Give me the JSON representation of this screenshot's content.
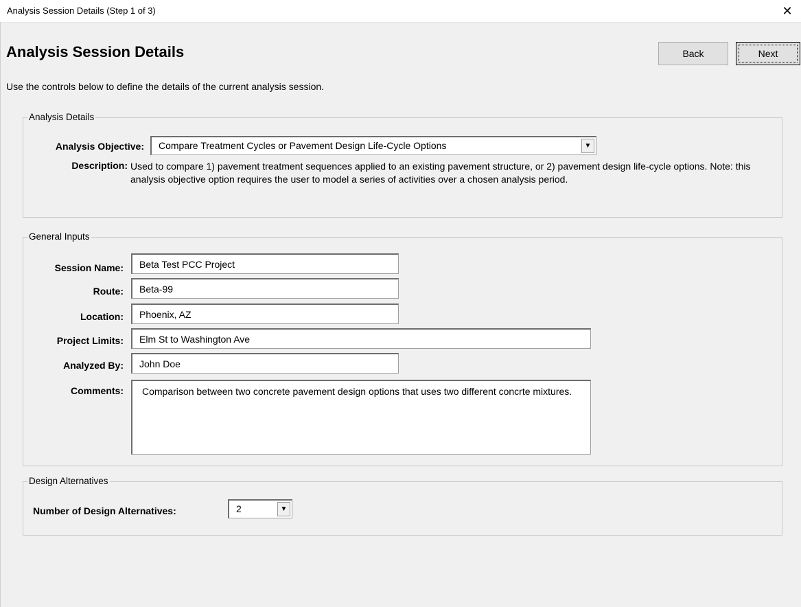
{
  "window": {
    "title": "Analysis Session Details (Step 1 of 3)",
    "close_glyph": "✕"
  },
  "header": {
    "heading": "Analysis Session Details",
    "intro": "Use the controls below to define the details of the current analysis session.",
    "back_label": "Back",
    "next_label": "Next"
  },
  "analysis_details": {
    "group_label": "Analysis Details",
    "objective_label": "Analysis Objective:",
    "objective_value": "Compare Treatment Cycles or Pavement Design Life-Cycle Options",
    "description_label": "Description:",
    "description_text": "Used to compare 1) pavement treatment sequences applied to an existing pavement structure, or 2) pavement design life-cycle options.  Note: this analysis objective option requires the user to model a series of activities over a chosen analysis period."
  },
  "general_inputs": {
    "group_label": "General Inputs",
    "session_name_label": "Session Name:",
    "session_name_value": "Beta Test PCC Project",
    "route_label": "Route:",
    "route_value": "Beta-99",
    "location_label": "Location:",
    "location_value": "Phoenix, AZ",
    "project_limits_label": "Project Limits:",
    "project_limits_value": "Elm St to Washington Ave",
    "analyzed_by_label": "Analyzed By:",
    "analyzed_by_value": "John Doe",
    "comments_label": "Comments:",
    "comments_value": "Comparison between two concrete pavement design options that uses two different concrte mixtures."
  },
  "design_alternatives": {
    "group_label": "Design Alternatives",
    "count_label": "Number of Design Alternatives:",
    "count_value": "2"
  }
}
